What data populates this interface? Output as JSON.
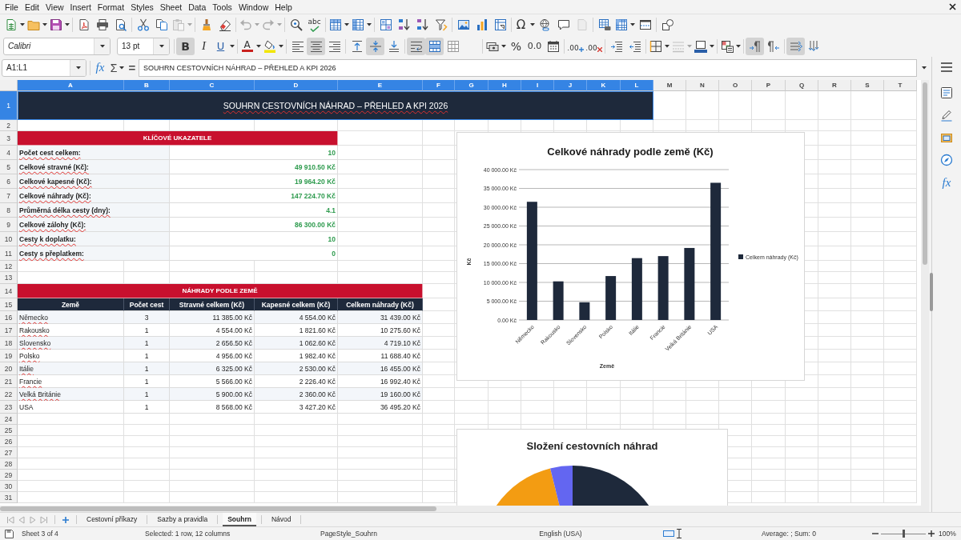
{
  "menu_bar": {
    "items": [
      "File",
      "Edit",
      "View",
      "Insert",
      "Format",
      "Styles",
      "Sheet",
      "Data",
      "Tools",
      "Window",
      "Help"
    ]
  },
  "standard_toolbar": {
    "groups": [
      [
        {
          "kind": "new",
          "pressed": false,
          "disabled": false
        },
        {
          "kind": "dropdown",
          "pressed": false,
          "disabled": false
        },
        {
          "kind": "open",
          "pressed": false,
          "disabled": false
        },
        {
          "kind": "dropdown",
          "pressed": false,
          "disabled": false
        },
        {
          "kind": "save",
          "pressed": false,
          "disabled": false
        },
        {
          "kind": "dropdown",
          "pressed": false,
          "disabled": false
        }
      ],
      [
        {
          "kind": "export-pdf",
          "pressed": false,
          "disabled": false
        },
        {
          "kind": "print",
          "pressed": false,
          "disabled": false
        },
        {
          "kind": "print-preview",
          "pressed": false,
          "disabled": false
        }
      ],
      [
        {
          "kind": "cut",
          "pressed": false,
          "disabled": false
        },
        {
          "kind": "copy",
          "pressed": false,
          "disabled": false
        },
        {
          "kind": "paste",
          "pressed": false,
          "disabled": true
        },
        {
          "kind": "dropdown",
          "pressed": false,
          "disabled": true
        }
      ],
      [
        {
          "kind": "clone-formatting",
          "pressed": false,
          "disabled": false
        },
        {
          "kind": "clear-formatting",
          "pressed": false,
          "disabled": false
        }
      ],
      [
        {
          "kind": "undo",
          "pressed": false,
          "disabled": true
        },
        {
          "kind": "dropdown",
          "pressed": false,
          "disabled": true
        },
        {
          "kind": "redo",
          "pressed": false,
          "disabled": true
        },
        {
          "kind": "dropdown",
          "pressed": false,
          "disabled": true
        }
      ],
      [
        {
          "kind": "find-replace",
          "pressed": false,
          "disabled": false
        },
        {
          "kind": "spelling",
          "label": "abc",
          "pressed": false,
          "disabled": false
        }
      ],
      [
        {
          "kind": "rows",
          "pressed": false,
          "disabled": false
        },
        {
          "kind": "dropdown",
          "pressed": false,
          "disabled": false
        },
        {
          "kind": "columns",
          "pressed": false,
          "disabled": false
        },
        {
          "kind": "dropdown",
          "pressed": false,
          "disabled": false
        }
      ],
      [
        {
          "kind": "sort",
          "pressed": false,
          "disabled": false
        },
        {
          "kind": "sort-ascending",
          "pressed": false,
          "disabled": false
        },
        {
          "kind": "sort-descending",
          "pressed": false,
          "disabled": false
        },
        {
          "kind": "autofilter",
          "pressed": false,
          "disabled": false
        }
      ],
      [
        {
          "kind": "image",
          "pressed": false,
          "disabled": false
        },
        {
          "kind": "chart",
          "pressed": false,
          "disabled": false
        },
        {
          "kind": "pivot-table",
          "pressed": false,
          "disabled": false
        }
      ],
      [
        {
          "kind": "special-character",
          "label": "Ω",
          "pressed": false,
          "disabled": false
        },
        {
          "kind": "dropdown",
          "pressed": false,
          "disabled": false
        },
        {
          "kind": "hyperlink",
          "pressed": false,
          "disabled": false
        },
        {
          "kind": "comment",
          "pressed": false,
          "disabled": false
        },
        {
          "kind": "headers-footers",
          "pressed": false,
          "disabled": true
        }
      ],
      [
        {
          "kind": "print-area",
          "pressed": false,
          "disabled": false
        },
        {
          "kind": "freeze",
          "pressed": false,
          "disabled": false
        },
        {
          "kind": "dropdown",
          "pressed": false,
          "disabled": false
        },
        {
          "kind": "split-window",
          "pressed": false,
          "disabled": false
        }
      ],
      [
        {
          "kind": "shapes",
          "pressed": false,
          "disabled": false
        }
      ]
    ]
  },
  "formatting_toolbar": {
    "font_name": "Calibri",
    "font_size": "13 pt",
    "groups": [
      [
        {
          "kind": "bold",
          "label": "B",
          "pressed": true,
          "disabled": false
        },
        {
          "kind": "italic",
          "label": "I",
          "pressed": false,
          "disabled": false
        },
        {
          "kind": "underline",
          "label": "U",
          "pressed": false,
          "disabled": false
        },
        {
          "kind": "dropdown",
          "pressed": false,
          "disabled": false
        }
      ],
      [
        {
          "kind": "font-color",
          "label": "A",
          "pressed": false,
          "disabled": false
        },
        {
          "kind": "dropdown",
          "pressed": false,
          "disabled": false
        },
        {
          "kind": "highlight",
          "pressed": false,
          "disabled": false
        },
        {
          "kind": "dropdown",
          "pressed": false,
          "disabled": false
        }
      ],
      [
        {
          "kind": "align-left",
          "pressed": false,
          "disabled": false
        },
        {
          "kind": "align-center",
          "pressed": true,
          "disabled": false
        },
        {
          "kind": "align-right",
          "pressed": false,
          "disabled": false
        }
      ],
      [
        {
          "kind": "align-top",
          "pressed": false,
          "disabled": false
        },
        {
          "kind": "align-middle",
          "pressed": true,
          "disabled": false
        },
        {
          "kind": "align-bottom",
          "pressed": false,
          "disabled": false
        }
      ],
      [
        {
          "kind": "wrap-text",
          "pressed": true,
          "disabled": false
        },
        {
          "kind": "merge-cells",
          "pressed": true,
          "disabled": false
        },
        {
          "kind": "unmerge-cells",
          "pressed": false,
          "disabled": false
        }
      ],
      [
        {
          "kind": "currency-format",
          "pressed": false,
          "disabled": false
        },
        {
          "kind": "dropdown",
          "pressed": false,
          "disabled": false
        },
        {
          "kind": "percent-format",
          "label": "%",
          "pressed": false,
          "disabled": false
        },
        {
          "kind": "number-format",
          "label": "0.0",
          "pressed": false,
          "disabled": false
        },
        {
          "kind": "date-format",
          "pressed": false,
          "disabled": false
        }
      ],
      [
        {
          "kind": "add-decimal",
          "label": ".00",
          "pressed": false,
          "disabled": false
        },
        {
          "kind": "delete-decimal",
          "label": ".00",
          "pressed": false,
          "disabled": false
        }
      ],
      [
        {
          "kind": "increase-indent",
          "pressed": false,
          "disabled": false
        },
        {
          "kind": "decrease-indent",
          "pressed": false,
          "disabled": false
        }
      ],
      [
        {
          "kind": "borders",
          "pressed": false,
          "disabled": false
        },
        {
          "kind": "dropdown",
          "pressed": false,
          "disabled": false
        },
        {
          "kind": "border-style",
          "pressed": false,
          "disabled": true
        },
        {
          "kind": "dropdown",
          "pressed": false,
          "disabled": true
        },
        {
          "kind": "border-color",
          "pressed": false,
          "disabled": false
        },
        {
          "kind": "dropdown",
          "pressed": false,
          "disabled": false
        }
      ],
      [
        {
          "kind": "conditional-format",
          "pressed": false,
          "disabled": false
        },
        {
          "kind": "dropdown",
          "pressed": false,
          "disabled": false
        }
      ],
      [
        {
          "kind": "left-to-right",
          "pressed": true,
          "disabled": false
        },
        {
          "kind": "right-to-left",
          "pressed": false,
          "disabled": false
        }
      ],
      [
        {
          "kind": "text-horizontal",
          "pressed": true,
          "disabled": false
        },
        {
          "kind": "text-vertical",
          "pressed": false,
          "disabled": false
        }
      ]
    ]
  },
  "formula_bar": {
    "name_box": "A1:L1",
    "function_wizard": "fx",
    "sum": "Σ",
    "formula": "=",
    "content": "SOUHRN CESTOVNÍCH NÁHRAD – PŘEHLED A KPI 2026"
  },
  "sheet": {
    "columns": [
      {
        "label": "A",
        "selected": true
      },
      {
        "label": "B",
        "selected": true
      },
      {
        "label": "C",
        "selected": true
      },
      {
        "label": "D",
        "selected": true
      },
      {
        "label": "E",
        "selected": true
      },
      {
        "label": "F",
        "selected": true
      },
      {
        "label": "G",
        "selected": true
      },
      {
        "label": "H",
        "selected": true
      },
      {
        "label": "I",
        "selected": true
      },
      {
        "label": "J",
        "selected": true
      },
      {
        "label": "K",
        "selected": true
      },
      {
        "label": "L",
        "selected": true
      },
      {
        "label": "M",
        "selected": false
      },
      {
        "label": "N",
        "selected": false
      },
      {
        "label": "O",
        "selected": false
      },
      {
        "label": "P",
        "selected": false
      },
      {
        "label": "Q",
        "selected": false
      },
      {
        "label": "R",
        "selected": false
      },
      {
        "label": "S",
        "selected": false
      },
      {
        "label": "T",
        "selected": false
      }
    ],
    "rows": [
      {
        "label": "1",
        "selected": true
      },
      {
        "label": "2",
        "selected": false
      },
      {
        "label": "3",
        "selected": false
      },
      {
        "label": "4",
        "selected": false
      },
      {
        "label": "5",
        "selected": false
      },
      {
        "label": "6",
        "selected": false
      },
      {
        "label": "7",
        "selected": false
      },
      {
        "label": "8",
        "selected": false
      },
      {
        "label": "9",
        "selected": false
      },
      {
        "label": "10",
        "selected": false
      },
      {
        "label": "11",
        "selected": false
      },
      {
        "label": "12",
        "selected": false
      },
      {
        "label": "13",
        "selected": false
      },
      {
        "label": "14",
        "selected": false
      },
      {
        "label": "15",
        "selected": false
      },
      {
        "label": "16",
        "selected": false
      },
      {
        "label": "17",
        "selected": false
      },
      {
        "label": "18",
        "selected": false
      },
      {
        "label": "19",
        "selected": false
      },
      {
        "label": "20",
        "selected": false
      },
      {
        "label": "21",
        "selected": false
      },
      {
        "label": "22",
        "selected": false
      },
      {
        "label": "23",
        "selected": false
      },
      {
        "label": "24",
        "selected": false
      },
      {
        "label": "25",
        "selected": false
      },
      {
        "label": "26",
        "selected": false
      },
      {
        "label": "27",
        "selected": false
      },
      {
        "label": "28",
        "selected": false
      },
      {
        "label": "29",
        "selected": false
      },
      {
        "label": "30",
        "selected": false
      },
      {
        "label": "31",
        "selected": false
      }
    ],
    "title": {
      "text": "SOUHRN CESTOVNÍCH NÁHRAD – PŘEHLED A KPI 2026",
      "selected": true,
      "misspelled": true
    },
    "kpi_header": "KLÍČOVÉ UKAZATELE",
    "kpis": [
      {
        "label": "Počet cest celkem:",
        "value": "10",
        "misspelled": true
      },
      {
        "label": "Celkové stravné (Kč):",
        "value": "49 910.50 Kč",
        "misspelled": true
      },
      {
        "label": "Celkové kapesné (Kč):",
        "value": "19 964.20 Kč",
        "misspelled": true
      },
      {
        "label": "Celkové náhrady (Kč):",
        "value": "147 224.70 Kč",
        "misspelled": true
      },
      {
        "label": "Průměrná délka cesty (dny):",
        "value": "4.1",
        "misspelled": true
      },
      {
        "label": "Celkové zálohy (Kč):",
        "value": "86 300.00 Kč",
        "misspelled": true
      },
      {
        "label": "Cesty k doplatku:",
        "value": "10",
        "misspelled": true
      },
      {
        "label": "Cesty s přeplatkem:",
        "value": "0",
        "misspelled": true
      }
    ],
    "country_header": "NÁHRADY PODLE ZEMĚ",
    "country_table": {
      "columns": [
        "Země",
        "Počet cest",
        "Stravné celkem (Kč)",
        "Kapesné celkem (Kč)",
        "Celkem náhrady (Kč)"
      ],
      "rows": [
        {
          "cells": [
            "Německo",
            "3",
            "11 385.00 Kč",
            "4 554.00 Kč",
            "31 439.00 Kč"
          ],
          "misspelled": true
        },
        {
          "cells": [
            "Rakousko",
            "1",
            "4 554.00 Kč",
            "1 821.60 Kč",
            "10 275.60 Kč"
          ],
          "misspelled": true
        },
        {
          "cells": [
            "Slovensko",
            "1",
            "2 656.50 Kč",
            "1 062.60 Kč",
            "4 719.10 Kč"
          ],
          "misspelled": true
        },
        {
          "cells": [
            "Polsko",
            "1",
            "4 956.00 Kč",
            "1 982.40 Kč",
            "11 688.40 Kč"
          ],
          "misspelled": true
        },
        {
          "cells": [
            "Itálie",
            "1",
            "6 325.00 Kč",
            "2 530.00 Kč",
            "16 455.00 Kč"
          ],
          "misspelled": true
        },
        {
          "cells": [
            "Francie",
            "1",
            "5 566.00 Kč",
            "2 226.40 Kč",
            "16 992.40 Kč"
          ],
          "misspelled": true
        },
        {
          "cells": [
            "Velká Británie",
            "1",
            "5 900.00 Kč",
            "2 360.00 Kč",
            "19 160.00 Kč"
          ],
          "misspelled": true
        },
        {
          "cells": [
            "USA",
            "1",
            "8 568.00 Kč",
            "3 427.20 Kč",
            "36 495.20 Kč"
          ],
          "misspelled": false
        }
      ]
    },
    "bar_chart": {
      "chart_data": {
        "type": "bar",
        "title": "Celkové náhrady podle země (Kč)",
        "xlabel": "Země",
        "ylabel": "Kč",
        "categories": [
          "Německo",
          "Rakousko",
          "Slovensko",
          "Polsko",
          "Itálie",
          "Francie",
          "Velká Británie",
          "USA"
        ],
        "series": [
          {
            "name": "Celkem náhrady (Kč)",
            "color": "#1e293b",
            "values": [
              31439,
              10275.6,
              4719.1,
              11688.4,
              16455,
              16992.4,
              19160,
              36495.2
            ]
          }
        ],
        "ylim": [
          0,
          40000
        ],
        "yticks": [
          {
            "value": 0,
            "label": "0.00 Kč"
          },
          {
            "value": 5000,
            "label": "5 000.00 Kč"
          },
          {
            "value": 10000,
            "label": "10 000.00 Kč"
          },
          {
            "value": 15000,
            "label": "15 000.00 Kč"
          },
          {
            "value": 20000,
            "label": "20 000.00 Kč"
          },
          {
            "value": 25000,
            "label": "25 000.00 Kč"
          },
          {
            "value": 30000,
            "label": "30 000.00 Kč"
          },
          {
            "value": 35000,
            "label": "35 000.00 Kč"
          },
          {
            "value": 40000,
            "label": "40 000.00 Kč"
          }
        ],
        "grid": true
      }
    },
    "pie_chart": {
      "title": "Složení cestovních náhrad"
    }
  },
  "sidebar": {
    "items": [
      {
        "kind": "properties",
        "selected": false
      },
      {
        "kind": "styles",
        "selected": false
      },
      {
        "kind": "gallery",
        "selected": false
      },
      {
        "kind": "navigator",
        "selected": false
      },
      {
        "kind": "functions",
        "label": "fx",
        "selected": false
      }
    ]
  },
  "sheet_tabs": {
    "navigation": [
      {
        "kind": "first",
        "disabled": true
      },
      {
        "kind": "previous",
        "disabled": true
      },
      {
        "kind": "next",
        "disabled": true
      },
      {
        "kind": "last",
        "disabled": true
      }
    ],
    "tabs": [
      {
        "label": "Cestovní příkazy",
        "selected": false
      },
      {
        "label": "Sazby a pravidla",
        "selected": false
      },
      {
        "label": "Souhrn",
        "selected": true
      },
      {
        "label": "Návod",
        "selected": false
      }
    ]
  },
  "status_bar": {
    "sheet": "Sheet 3 of 4",
    "selection": "Selected: 1 row, 12 columns",
    "page_style": "PageStyle_Souhrn",
    "language": "English (USA)",
    "summary": "Average: ; Sum: 0",
    "zoom": {
      "level": 0.5,
      "reading": "100%"
    }
  }
}
